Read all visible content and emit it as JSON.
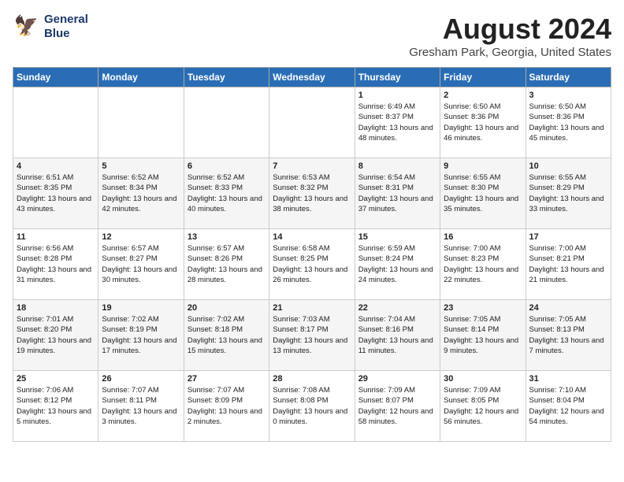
{
  "header": {
    "logo_line1": "General",
    "logo_line2": "Blue",
    "month": "August 2024",
    "location": "Gresham Park, Georgia, United States"
  },
  "days_of_week": [
    "Sunday",
    "Monday",
    "Tuesday",
    "Wednesday",
    "Thursday",
    "Friday",
    "Saturday"
  ],
  "weeks": [
    [
      {
        "day": "",
        "sunrise": "",
        "sunset": "",
        "daylight": ""
      },
      {
        "day": "",
        "sunrise": "",
        "sunset": "",
        "daylight": ""
      },
      {
        "day": "",
        "sunrise": "",
        "sunset": "",
        "daylight": ""
      },
      {
        "day": "",
        "sunrise": "",
        "sunset": "",
        "daylight": ""
      },
      {
        "day": "1",
        "sunrise": "6:49 AM",
        "sunset": "8:37 PM",
        "daylight": "13 hours and 48 minutes."
      },
      {
        "day": "2",
        "sunrise": "6:50 AM",
        "sunset": "8:36 PM",
        "daylight": "13 hours and 46 minutes."
      },
      {
        "day": "3",
        "sunrise": "6:50 AM",
        "sunset": "8:36 PM",
        "daylight": "13 hours and 45 minutes."
      }
    ],
    [
      {
        "day": "4",
        "sunrise": "6:51 AM",
        "sunset": "8:35 PM",
        "daylight": "13 hours and 43 minutes."
      },
      {
        "day": "5",
        "sunrise": "6:52 AM",
        "sunset": "8:34 PM",
        "daylight": "13 hours and 42 minutes."
      },
      {
        "day": "6",
        "sunrise": "6:52 AM",
        "sunset": "8:33 PM",
        "daylight": "13 hours and 40 minutes."
      },
      {
        "day": "7",
        "sunrise": "6:53 AM",
        "sunset": "8:32 PM",
        "daylight": "13 hours and 38 minutes."
      },
      {
        "day": "8",
        "sunrise": "6:54 AM",
        "sunset": "8:31 PM",
        "daylight": "13 hours and 37 minutes."
      },
      {
        "day": "9",
        "sunrise": "6:55 AM",
        "sunset": "8:30 PM",
        "daylight": "13 hours and 35 minutes."
      },
      {
        "day": "10",
        "sunrise": "6:55 AM",
        "sunset": "8:29 PM",
        "daylight": "13 hours and 33 minutes."
      }
    ],
    [
      {
        "day": "11",
        "sunrise": "6:56 AM",
        "sunset": "8:28 PM",
        "daylight": "13 hours and 31 minutes."
      },
      {
        "day": "12",
        "sunrise": "6:57 AM",
        "sunset": "8:27 PM",
        "daylight": "13 hours and 30 minutes."
      },
      {
        "day": "13",
        "sunrise": "6:57 AM",
        "sunset": "8:26 PM",
        "daylight": "13 hours and 28 minutes."
      },
      {
        "day": "14",
        "sunrise": "6:58 AM",
        "sunset": "8:25 PM",
        "daylight": "13 hours and 26 minutes."
      },
      {
        "day": "15",
        "sunrise": "6:59 AM",
        "sunset": "8:24 PM",
        "daylight": "13 hours and 24 minutes."
      },
      {
        "day": "16",
        "sunrise": "7:00 AM",
        "sunset": "8:23 PM",
        "daylight": "13 hours and 22 minutes."
      },
      {
        "day": "17",
        "sunrise": "7:00 AM",
        "sunset": "8:21 PM",
        "daylight": "13 hours and 21 minutes."
      }
    ],
    [
      {
        "day": "18",
        "sunrise": "7:01 AM",
        "sunset": "8:20 PM",
        "daylight": "13 hours and 19 minutes."
      },
      {
        "day": "19",
        "sunrise": "7:02 AM",
        "sunset": "8:19 PM",
        "daylight": "13 hours and 17 minutes."
      },
      {
        "day": "20",
        "sunrise": "7:02 AM",
        "sunset": "8:18 PM",
        "daylight": "13 hours and 15 minutes."
      },
      {
        "day": "21",
        "sunrise": "7:03 AM",
        "sunset": "8:17 PM",
        "daylight": "13 hours and 13 minutes."
      },
      {
        "day": "22",
        "sunrise": "7:04 AM",
        "sunset": "8:16 PM",
        "daylight": "13 hours and 11 minutes."
      },
      {
        "day": "23",
        "sunrise": "7:05 AM",
        "sunset": "8:14 PM",
        "daylight": "13 hours and 9 minutes."
      },
      {
        "day": "24",
        "sunrise": "7:05 AM",
        "sunset": "8:13 PM",
        "daylight": "13 hours and 7 minutes."
      }
    ],
    [
      {
        "day": "25",
        "sunrise": "7:06 AM",
        "sunset": "8:12 PM",
        "daylight": "13 hours and 5 minutes."
      },
      {
        "day": "26",
        "sunrise": "7:07 AM",
        "sunset": "8:11 PM",
        "daylight": "13 hours and 3 minutes."
      },
      {
        "day": "27",
        "sunrise": "7:07 AM",
        "sunset": "8:09 PM",
        "daylight": "13 hours and 2 minutes."
      },
      {
        "day": "28",
        "sunrise": "7:08 AM",
        "sunset": "8:08 PM",
        "daylight": "13 hours and 0 minutes."
      },
      {
        "day": "29",
        "sunrise": "7:09 AM",
        "sunset": "8:07 PM",
        "daylight": "12 hours and 58 minutes."
      },
      {
        "day": "30",
        "sunrise": "7:09 AM",
        "sunset": "8:05 PM",
        "daylight": "12 hours and 56 minutes."
      },
      {
        "day": "31",
        "sunrise": "7:10 AM",
        "sunset": "8:04 PM",
        "daylight": "12 hours and 54 minutes."
      }
    ]
  ]
}
